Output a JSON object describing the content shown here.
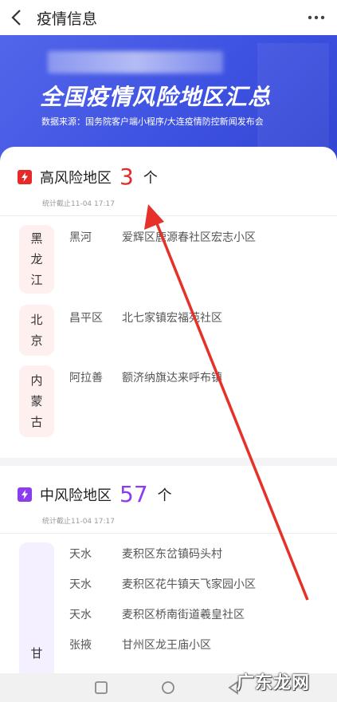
{
  "header": {
    "title": "疫情信息"
  },
  "banner": {
    "headline": "全国疫情风险地区汇总",
    "source": "数据来源：国务院客户端小程序/大连疫情防控新闻发布会"
  },
  "high_risk": {
    "label": "高风险地区",
    "count": "3",
    "unit": "个",
    "timestamp": "统计截止11-04 17:17",
    "color": "#e52a2a",
    "provinces": [
      {
        "name": "黑龙江",
        "chars": [
          "黑",
          "龙",
          "江"
        ],
        "city": "黑河",
        "area": "爱辉区鹿源春社区宏志小区"
      },
      {
        "name": "北京",
        "chars": [
          "北",
          "京"
        ],
        "city": "昌平区",
        "area": "北七家镇宏福苑社区"
      },
      {
        "name": "内蒙古",
        "chars": [
          "内",
          "蒙",
          "古"
        ],
        "city": "阿拉善",
        "area": "额济纳旗达来呼布镇"
      }
    ]
  },
  "mid_risk": {
    "label": "中风险地区",
    "count": "57",
    "unit": "个",
    "timestamp": "统计截止11-04 17:17",
    "color": "#8b3bf0",
    "province_char": "甘",
    "rows": [
      {
        "city": "天水",
        "area": "麦积区东岔镇码头村"
      },
      {
        "city": "天水",
        "area": "麦积区花牛镇天飞家园小区"
      },
      {
        "city": "天水",
        "area": "麦积区桥南街道羲皇社区"
      },
      {
        "city": "张掖",
        "area": "甘州区龙王庙小区"
      }
    ]
  },
  "watermark": "广东龙网"
}
